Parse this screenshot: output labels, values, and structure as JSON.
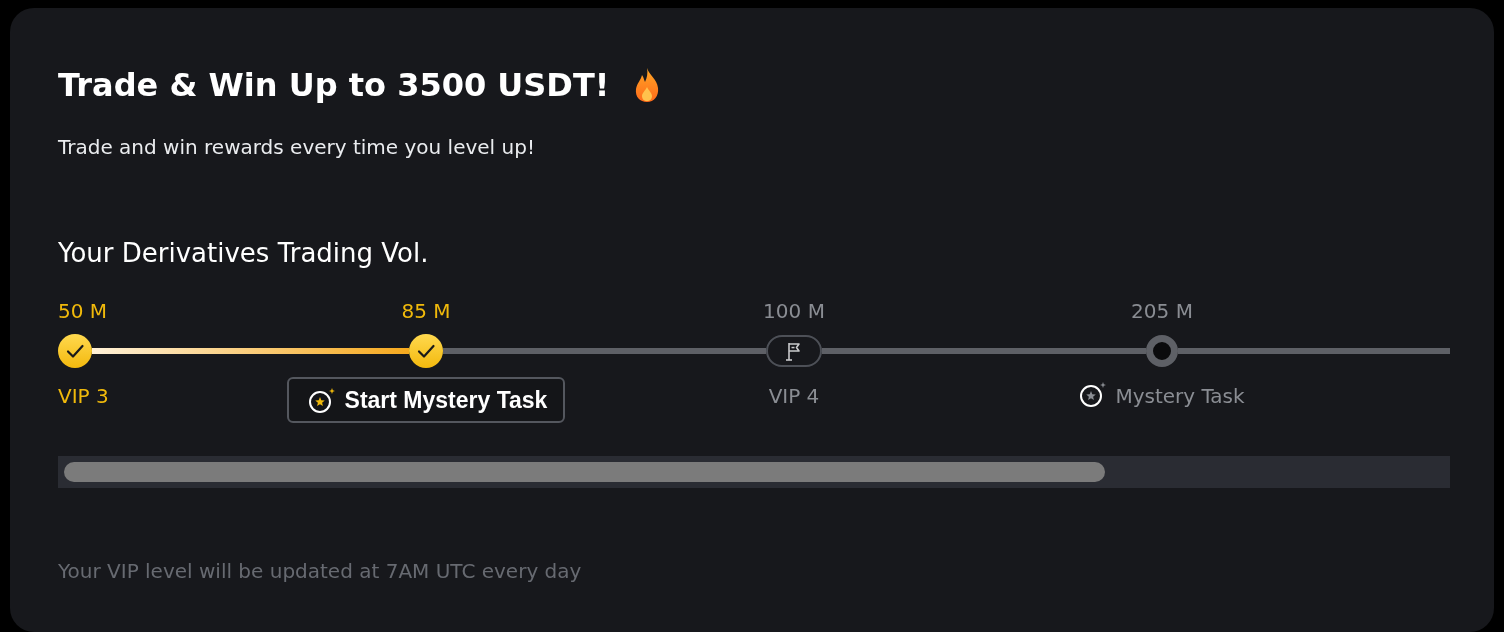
{
  "title": "Trade & Win Up to 3500 USDT!",
  "subtitle": "Trade and win rewards every time you level up!",
  "section": {
    "heading": "Your Derivatives Trading Vol.",
    "milestones": [
      {
        "value": "50 M",
        "label": "VIP 3",
        "kind": "vip",
        "reached": true
      },
      {
        "value": "85 M",
        "label": "Start Mystery Task",
        "kind": "task",
        "reached": true
      },
      {
        "value": "100 M",
        "label": "VIP 4",
        "kind": "vip",
        "reached": false
      },
      {
        "value": "205 M",
        "label": "Mystery Task",
        "kind": "task",
        "reached": false
      }
    ]
  },
  "footer": "Your VIP level will be updated at 7AM UTC every day"
}
